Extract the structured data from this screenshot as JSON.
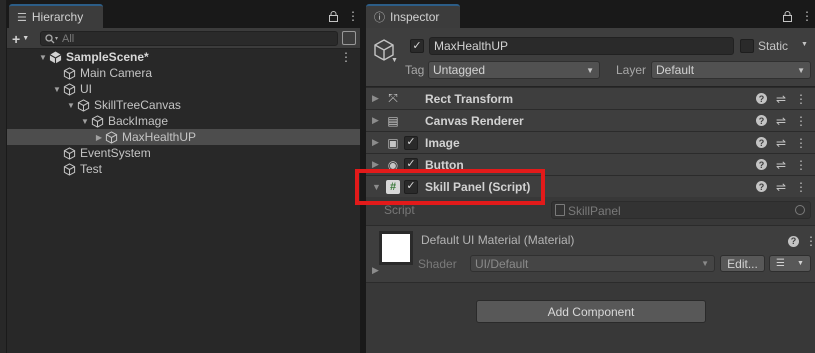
{
  "hierarchy": {
    "tab_label": "Hierarchy",
    "search_placeholder": "All",
    "tree": [
      {
        "label": "SampleScene*",
        "indent": 0,
        "arrow": "down",
        "kind": "scene",
        "bold": true,
        "menu": true,
        "selected": false
      },
      {
        "label": "Main Camera",
        "indent": 1,
        "arrow": "",
        "kind": "cube",
        "bold": false,
        "menu": false,
        "selected": false
      },
      {
        "label": "UI",
        "indent": 1,
        "arrow": "down",
        "kind": "cube",
        "bold": false,
        "menu": false,
        "selected": false
      },
      {
        "label": "SkillTreeCanvas",
        "indent": 2,
        "arrow": "down",
        "kind": "cube",
        "bold": false,
        "menu": false,
        "selected": false
      },
      {
        "label": "BackImage",
        "indent": 3,
        "arrow": "down",
        "kind": "cube",
        "bold": false,
        "menu": false,
        "selected": false
      },
      {
        "label": "MaxHealthUP",
        "indent": 4,
        "arrow": "right",
        "kind": "cube",
        "bold": false,
        "menu": false,
        "selected": true
      },
      {
        "label": "EventSystem",
        "indent": 1,
        "arrow": "",
        "kind": "cube",
        "bold": false,
        "menu": false,
        "selected": false
      },
      {
        "label": "Test",
        "indent": 1,
        "arrow": "",
        "kind": "cube",
        "bold": false,
        "menu": false,
        "selected": false
      }
    ]
  },
  "inspector": {
    "tab_label": "Inspector",
    "object_name": "MaxHealthUP",
    "static_label": "Static",
    "tag_label": "Tag",
    "tag_value": "Untagged",
    "layer_label": "Layer",
    "layer_value": "Default",
    "components": [
      {
        "name": "Rect Transform",
        "icon": "rect-transform-icon",
        "glyph": "⤧",
        "has_check": false
      },
      {
        "name": "Canvas Renderer",
        "icon": "canvas-renderer-icon",
        "glyph": "▤",
        "has_check": false
      },
      {
        "name": "Image",
        "icon": "image-icon",
        "glyph": "▣",
        "has_check": true
      },
      {
        "name": "Button",
        "icon": "button-icon",
        "glyph": "◉",
        "has_check": true
      },
      {
        "name": "Skill Panel (Script)",
        "icon": "script-icon",
        "glyph": "#",
        "has_check": true
      }
    ],
    "script_label": "Script",
    "script_value": "SkillPanel",
    "material_name": "Default UI Material (Material)",
    "shader_label": "Shader",
    "shader_value": "UI/Default",
    "edit_label": "Edit...",
    "add_component_label": "Add Component"
  },
  "colors": {
    "highlight": "#e21a1a",
    "tab_accent": "#2c5d87",
    "selected_row": "#4d4d4d"
  }
}
